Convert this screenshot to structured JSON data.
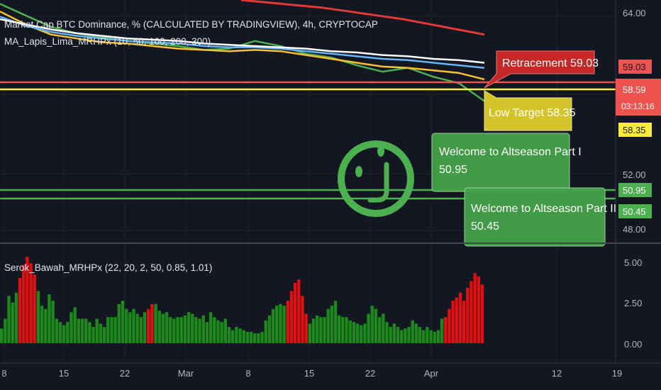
{
  "chart_data": [
    {
      "type": "line",
      "title": "Market Cap BTC Dominance, % (CALCULATED BY TRADINGVIEW), 4h, CRYPTOCAP",
      "subtitle": "MA_Lapis_Lima_MRHPx (10, 50, 100, 200, 300)",
      "y_ticks": [
        "64.00",
        "52.00",
        "48.00"
      ],
      "ylim": [
        47.5,
        66.5
      ],
      "x_ticks": [
        "8",
        "15",
        "22",
        "Mar",
        "8",
        "15",
        "22",
        "Apr",
        "12",
        "19"
      ],
      "series": [
        {
          "color": "#4caf50",
          "values": [
            66.2,
            65.3,
            64.4,
            63.9,
            63.6,
            63.3,
            63.1,
            62.9,
            62.6,
            62.7,
            63.3,
            62.9,
            62.3,
            62.0,
            61.4,
            60.9,
            61.2,
            60.5,
            60.0,
            58.6
          ]
        },
        {
          "color": "#fbc02d",
          "values": [
            65.6,
            64.6,
            63.8,
            63.5,
            63.2,
            63.1,
            62.9,
            62.7,
            62.6,
            62.5,
            62.6,
            62.5,
            62.2,
            61.9,
            61.6,
            61.3,
            61.2,
            61.0,
            60.8,
            60.3
          ]
        },
        {
          "color": "#64b5f6",
          "values": [
            65.2,
            64.5,
            64.0,
            63.7,
            63.5,
            63.3,
            63.2,
            63.1,
            62.9,
            62.8,
            62.8,
            62.7,
            62.5,
            62.3,
            62.1,
            61.9,
            61.8,
            61.6,
            61.4,
            61.2
          ]
        },
        {
          "color": "#ffffff",
          "values": [
            65.0,
            64.6,
            64.2,
            63.9,
            63.7,
            63.5,
            63.4,
            63.3,
            63.1,
            63.0,
            62.9,
            62.8,
            62.7,
            62.5,
            62.4,
            62.2,
            62.1,
            61.9,
            61.8,
            61.6
          ]
        },
        {
          "color": "#e53935",
          "values": [
            66.5,
            66.3,
            66.1,
            65.9,
            65.6,
            65.3,
            65.0,
            64.6,
            64.2,
            63.8
          ]
        }
      ],
      "price_labels": [
        {
          "value": "59.03",
          "color": "#ef5350"
        },
        {
          "value": "58.59",
          "color": "#ef5350"
        },
        {
          "value": "03:13:16",
          "color": "#ef5350"
        },
        {
          "value": "58.35",
          "color": "#ffeb3b"
        },
        {
          "value": "50.95",
          "color": "#4caf50"
        },
        {
          "value": "50.45",
          "color": "#4caf50"
        }
      ],
      "annotations": [
        {
          "text": "Retracement 59.03",
          "color": "#c62828"
        },
        {
          "text": "Low Target 58.35",
          "color": "#d4c42a"
        },
        {
          "text": "Welcome to Altseason Part I\n50.95",
          "color": "#43a047"
        },
        {
          "text": "Welcome to Altseason Part II\n50.45",
          "color": "#43a047"
        }
      ],
      "icon": "smiley-face-icon"
    },
    {
      "type": "bar",
      "title": "Serok_Bawah_MRHPx (22, 20, 2, 50, 0.85, 1.01)",
      "y_ticks": [
        "5.00",
        "2.50",
        "0.00"
      ],
      "ylim": [
        -0.3,
        5.6
      ],
      "series": [
        {
          "name": "",
          "color": "#1b8a1b",
          "values": [
            0.9,
            1.5,
            2.9,
            2.5,
            3.1,
            4.0,
            4.8,
            5.3,
            4.9,
            4.2,
            3.2,
            2.3,
            2.1,
            3.0,
            2.6,
            1.5,
            1.3,
            1.1,
            1.3,
            1.9,
            2.2,
            1.5,
            1.5,
            1.5,
            1.3,
            1.0,
            1.5,
            1.2,
            1.0,
            1.6,
            1.6,
            1.6,
            2.4,
            2.6,
            2.1,
            1.9,
            2.1,
            1.8,
            1.6,
            1.9,
            2.1,
            2.4,
            2.4,
            2.0,
            1.8,
            1.9,
            1.6,
            1.5,
            1.6,
            1.6,
            1.7,
            1.9,
            1.8,
            1.6,
            1.5,
            1.7,
            1.3,
            1.9,
            1.6,
            1.4,
            1.3,
            1.5,
            1.0,
            0.8,
            1.0,
            0.9,
            0.8,
            0.7,
            0.7,
            0.6,
            0.6,
            0.7,
            1.4,
            1.7,
            2.1,
            2.3,
            2.4,
            2.3,
            2.6,
            3.2,
            3.7,
            3.9,
            2.9,
            1.8,
            1.2,
            1.5,
            1.7,
            1.6,
            1.6,
            2.1,
            2.3,
            2.6,
            1.7,
            1.6,
            1.6,
            1.4,
            1.3,
            1.2,
            1.1,
            1.2,
            1.8,
            2.3,
            2.1,
            1.6,
            1.8,
            1.3,
            1.0,
            1.2,
            1.0,
            0.8,
            0.9,
            1.0,
            1.4,
            1.2,
            1.0,
            0.8,
            1.0,
            0.8,
            0.7,
            0.8,
            1.5,
            1.6,
            2.1,
            2.6,
            2.8,
            3.1,
            2.6,
            3.4,
            3.8,
            4.3,
            4.1,
            3.6
          ]
        }
      ]
    }
  ]
}
